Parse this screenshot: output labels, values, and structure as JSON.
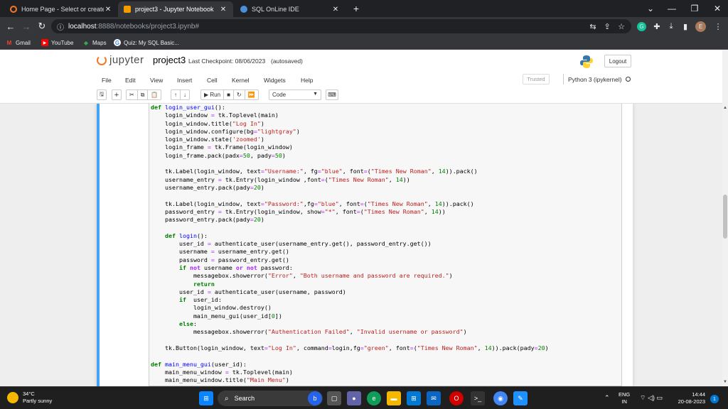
{
  "browser": {
    "tabs": [
      {
        "title": "Home Page - Select or create a n",
        "close": "✕",
        "favicon_color": "#f37726"
      },
      {
        "title": "project3 - Jupyter Notebook",
        "close": "✕",
        "favicon_color": "#f59b00"
      },
      {
        "title": "SQL OnLine IDE",
        "close": "✕",
        "favicon_color": "#4a90d9"
      }
    ],
    "new_tab": "+",
    "window_controls": {
      "tab_search": "⌄",
      "minimize": "—",
      "restore": "❐",
      "close": "✕"
    },
    "address": {
      "host": "localhost",
      "path": ":8888/notebooks/project3.ipynb#"
    },
    "nav": {
      "back": "←",
      "forward": "→",
      "reload": "↻",
      "info": "ⓘ"
    },
    "toolbar_icons": {
      "translate": "⇆",
      "share": "⇪",
      "bookmark": "☆",
      "extension_g": "G",
      "puzzle": "✚",
      "download": "⤓",
      "sidepanel": "▮",
      "profile": "E",
      "menu": "⋮"
    },
    "bookmarks": [
      {
        "label": "Gmail",
        "icon": "M",
        "color": "#ea4335"
      },
      {
        "label": "YouTube",
        "icon": "▶",
        "color": "#ff0000"
      },
      {
        "label": "Maps",
        "icon": "◆",
        "color": "#34a853"
      },
      {
        "label": "Quiz: My SQL Basic...",
        "icon": "G",
        "color": "#ffffff"
      }
    ]
  },
  "jupyter": {
    "logo_text": "jupyter",
    "notebook_name": "project3",
    "checkpoint": "Last Checkpoint: 08/06/2023",
    "autosave": "(autosaved)",
    "logout": "Logout",
    "menus": [
      "File",
      "Edit",
      "View",
      "Insert",
      "Cell",
      "Kernel",
      "Widgets",
      "Help"
    ],
    "trusted": "Trusted",
    "kernel": "Python 3 (ipykernel)",
    "toolbar": {
      "save": "🖫",
      "add": "+",
      "cut": "✂",
      "copy": "⧉",
      "paste": "📋",
      "up": "↑",
      "down": "↓",
      "run": "▶ Run",
      "stop": "■",
      "restart": "↻",
      "restart_run": "⏩",
      "cell_type": "Code",
      "keyboard": "⌨"
    }
  },
  "code_lines": [
    [
      [
        "kw",
        "def "
      ],
      [
        "fn",
        "login_user_gui"
      ],
      [
        "",
        "():"
      ]
    ],
    [
      [
        "",
        "    login_window "
      ],
      [
        "eq",
        "="
      ],
      [
        "",
        " tk.Toplevel(main)"
      ]
    ],
    [
      [
        "",
        "    login_window.title("
      ],
      [
        "st",
        "\"Log In\""
      ],
      [
        "",
        ")"
      ]
    ],
    [
      [
        "",
        "    login_window.configure(bg"
      ],
      [
        "eq",
        "="
      ],
      [
        "st",
        "\"lightgray\""
      ],
      [
        "",
        ")"
      ]
    ],
    [
      [
        "",
        "    login_window.state("
      ],
      [
        "st",
        "'zoomed'"
      ],
      [
        "",
        ")"
      ]
    ],
    [
      [
        "",
        "    login_frame "
      ],
      [
        "eq",
        "="
      ],
      [
        "",
        " tk.Frame(login_window)"
      ]
    ],
    [
      [
        "",
        "    login_frame.pack(padx"
      ],
      [
        "eq",
        "="
      ],
      [
        "nu",
        "50"
      ],
      [
        "",
        ", pady"
      ],
      [
        "eq",
        "="
      ],
      [
        "nu",
        "50"
      ],
      [
        "",
        ")"
      ]
    ],
    [
      [
        "",
        ""
      ]
    ],
    [
      [
        "",
        "    tk.Label(login_window, text"
      ],
      [
        "eq",
        "="
      ],
      [
        "st",
        "\"Username:\""
      ],
      [
        "",
        ", fg"
      ],
      [
        "eq",
        "="
      ],
      [
        "st",
        "\"blue\""
      ],
      [
        "",
        ", font"
      ],
      [
        "eq",
        "="
      ],
      [
        "",
        "("
      ],
      [
        "st",
        "\"Times New Roman\""
      ],
      [
        "",
        ", "
      ],
      [
        "nu",
        "14"
      ],
      [
        "",
        "))"
      ],
      [
        "",
        ".pack()"
      ]
    ],
    [
      [
        "",
        "    username_entry "
      ],
      [
        "eq",
        "="
      ],
      [
        "",
        " tk.Entry(login_window ,font"
      ],
      [
        "eq",
        "="
      ],
      [
        "",
        "("
      ],
      [
        "st",
        "\"Times New Roman\""
      ],
      [
        "",
        ", "
      ],
      [
        "nu",
        "14"
      ],
      [
        "",
        "))"
      ]
    ],
    [
      [
        "",
        "    username_entry.pack(pady"
      ],
      [
        "eq",
        "="
      ],
      [
        "nu",
        "20"
      ],
      [
        "",
        ")"
      ]
    ],
    [
      [
        "",
        ""
      ]
    ],
    [
      [
        "",
        "    tk.Label(login_window, text"
      ],
      [
        "eq",
        "="
      ],
      [
        "st",
        "\"Password:\""
      ],
      [
        "",
        ",fg"
      ],
      [
        "eq",
        "="
      ],
      [
        "st",
        "\"blue\""
      ],
      [
        "",
        ", font"
      ],
      [
        "eq",
        "="
      ],
      [
        "",
        "("
      ],
      [
        "st",
        "\"Times New Roman\""
      ],
      [
        "",
        ", "
      ],
      [
        "nu",
        "14"
      ],
      [
        "",
        "))"
      ],
      [
        "",
        ".pack()"
      ]
    ],
    [
      [
        "",
        "    password_entry "
      ],
      [
        "eq",
        "="
      ],
      [
        "",
        " tk.Entry(login_window, show"
      ],
      [
        "eq",
        "="
      ],
      [
        "st",
        "\"*\""
      ],
      [
        "",
        ", font"
      ],
      [
        "eq",
        "="
      ],
      [
        "",
        "("
      ],
      [
        "st",
        "\"Times New Roman\""
      ],
      [
        "",
        ", "
      ],
      [
        "nu",
        "14"
      ],
      [
        "",
        "))"
      ]
    ],
    [
      [
        "",
        "    password_entry.pack(pady"
      ],
      [
        "eq",
        "="
      ],
      [
        "nu",
        "20"
      ],
      [
        "",
        ")"
      ]
    ],
    [
      [
        "",
        ""
      ]
    ],
    [
      [
        "kw",
        "    def "
      ],
      [
        "fn",
        "login"
      ],
      [
        "",
        "():"
      ]
    ],
    [
      [
        "",
        "        user_id "
      ],
      [
        "eq",
        "="
      ],
      [
        "",
        " authenticate_user(username_entry.get(), password_entry.get())"
      ]
    ],
    [
      [
        "",
        "        username "
      ],
      [
        "eq",
        "="
      ],
      [
        "",
        " username_entry.get()"
      ]
    ],
    [
      [
        "",
        "        password "
      ],
      [
        "eq",
        "="
      ],
      [
        "",
        " password_entry.get()"
      ]
    ],
    [
      [
        "kw",
        "        if "
      ],
      [
        "op",
        "not"
      ],
      [
        "",
        " username "
      ],
      [
        "op",
        "or"
      ],
      [
        "op",
        " not"
      ],
      [
        "",
        " password:"
      ]
    ],
    [
      [
        "",
        "            messagebox.showerror("
      ],
      [
        "st",
        "\"Error\""
      ],
      [
        "",
        ", "
      ],
      [
        "st",
        "\"Both username and password are required.\""
      ],
      [
        "",
        ")"
      ]
    ],
    [
      [
        "kw",
        "            return"
      ]
    ],
    [
      [
        "",
        "        user_id "
      ],
      [
        "eq",
        "="
      ],
      [
        "",
        " authenticate_user(username, password)"
      ]
    ],
    [
      [
        "kw",
        "        if "
      ],
      [
        "",
        " user_id:"
      ]
    ],
    [
      [
        "",
        "            login_window.destroy()"
      ]
    ],
    [
      [
        "",
        "            main_menu_gui(user_id["
      ],
      [
        "nu",
        "0"
      ],
      [
        "",
        "])"
      ]
    ],
    [
      [
        "kw",
        "        else"
      ],
      [
        "",
        ":"
      ]
    ],
    [
      [
        "",
        "            messagebox.showerror("
      ],
      [
        "st",
        "\"Authentication Failed\""
      ],
      [
        "",
        ", "
      ],
      [
        "st",
        "\"Invalid username or password\""
      ],
      [
        "",
        ")"
      ]
    ],
    [
      [
        "",
        ""
      ]
    ],
    [
      [
        "",
        "    tk.Button(login_window, text"
      ],
      [
        "eq",
        "="
      ],
      [
        "st",
        "\"Log In\""
      ],
      [
        "",
        ", command"
      ],
      [
        "eq",
        "="
      ],
      [
        "",
        "login,fg"
      ],
      [
        "eq",
        "="
      ],
      [
        "st",
        "\"green\""
      ],
      [
        "",
        ", font"
      ],
      [
        "eq",
        "="
      ],
      [
        "",
        "("
      ],
      [
        "st",
        "\"Times New Roman\""
      ],
      [
        "",
        ", "
      ],
      [
        "nu",
        "14"
      ],
      [
        "",
        ")).pack(pady"
      ],
      [
        "eq",
        "="
      ],
      [
        "nu",
        "20"
      ],
      [
        "",
        ")"
      ]
    ],
    [
      [
        "",
        ""
      ]
    ],
    [
      [
        "kw",
        "def "
      ],
      [
        "fn",
        "main_menu_gui"
      ],
      [
        "",
        "(user_id):"
      ]
    ],
    [
      [
        "",
        "    main_menu_window "
      ],
      [
        "eq",
        "="
      ],
      [
        "",
        " tk.Toplevel(main)"
      ]
    ],
    [
      [
        "",
        "    main_menu_window.title("
      ],
      [
        "st",
        "\"Main Menu\""
      ],
      [
        "",
        ")"
      ]
    ]
  ],
  "taskbar": {
    "weather_temp": "34°C",
    "weather_desc": "Partly sunny",
    "search_icon": "⌕",
    "search": "Search",
    "lang_top": "ENG",
    "lang_bottom": "IN",
    "tray_up": "⌃",
    "tray_icons": "⌔ ◁) ▭",
    "time": "14:44",
    "date": "20-08-2023",
    "notifications": "1",
    "apps": [
      {
        "icon": "⊞",
        "color": "#0a84ff"
      },
      {
        "icon": "b",
        "color": "#2563eb"
      },
      {
        "icon": "▢",
        "color": "#555555"
      },
      {
        "icon": "●",
        "color": "#6264a7"
      },
      {
        "icon": "e",
        "color": "#0f9d58"
      },
      {
        "icon": "▬",
        "color": "#f5b800"
      },
      {
        "icon": "⊞",
        "color": "#0078d4"
      },
      {
        "icon": "✉",
        "color": "#0a66c2"
      },
      {
        "icon": "O",
        "color": "#d10000"
      },
      {
        "icon": ">_",
        "color": "#333333"
      },
      {
        "icon": "◉",
        "color": "#4285f4"
      },
      {
        "icon": "✎",
        "color": "#1e90ff"
      }
    ]
  }
}
